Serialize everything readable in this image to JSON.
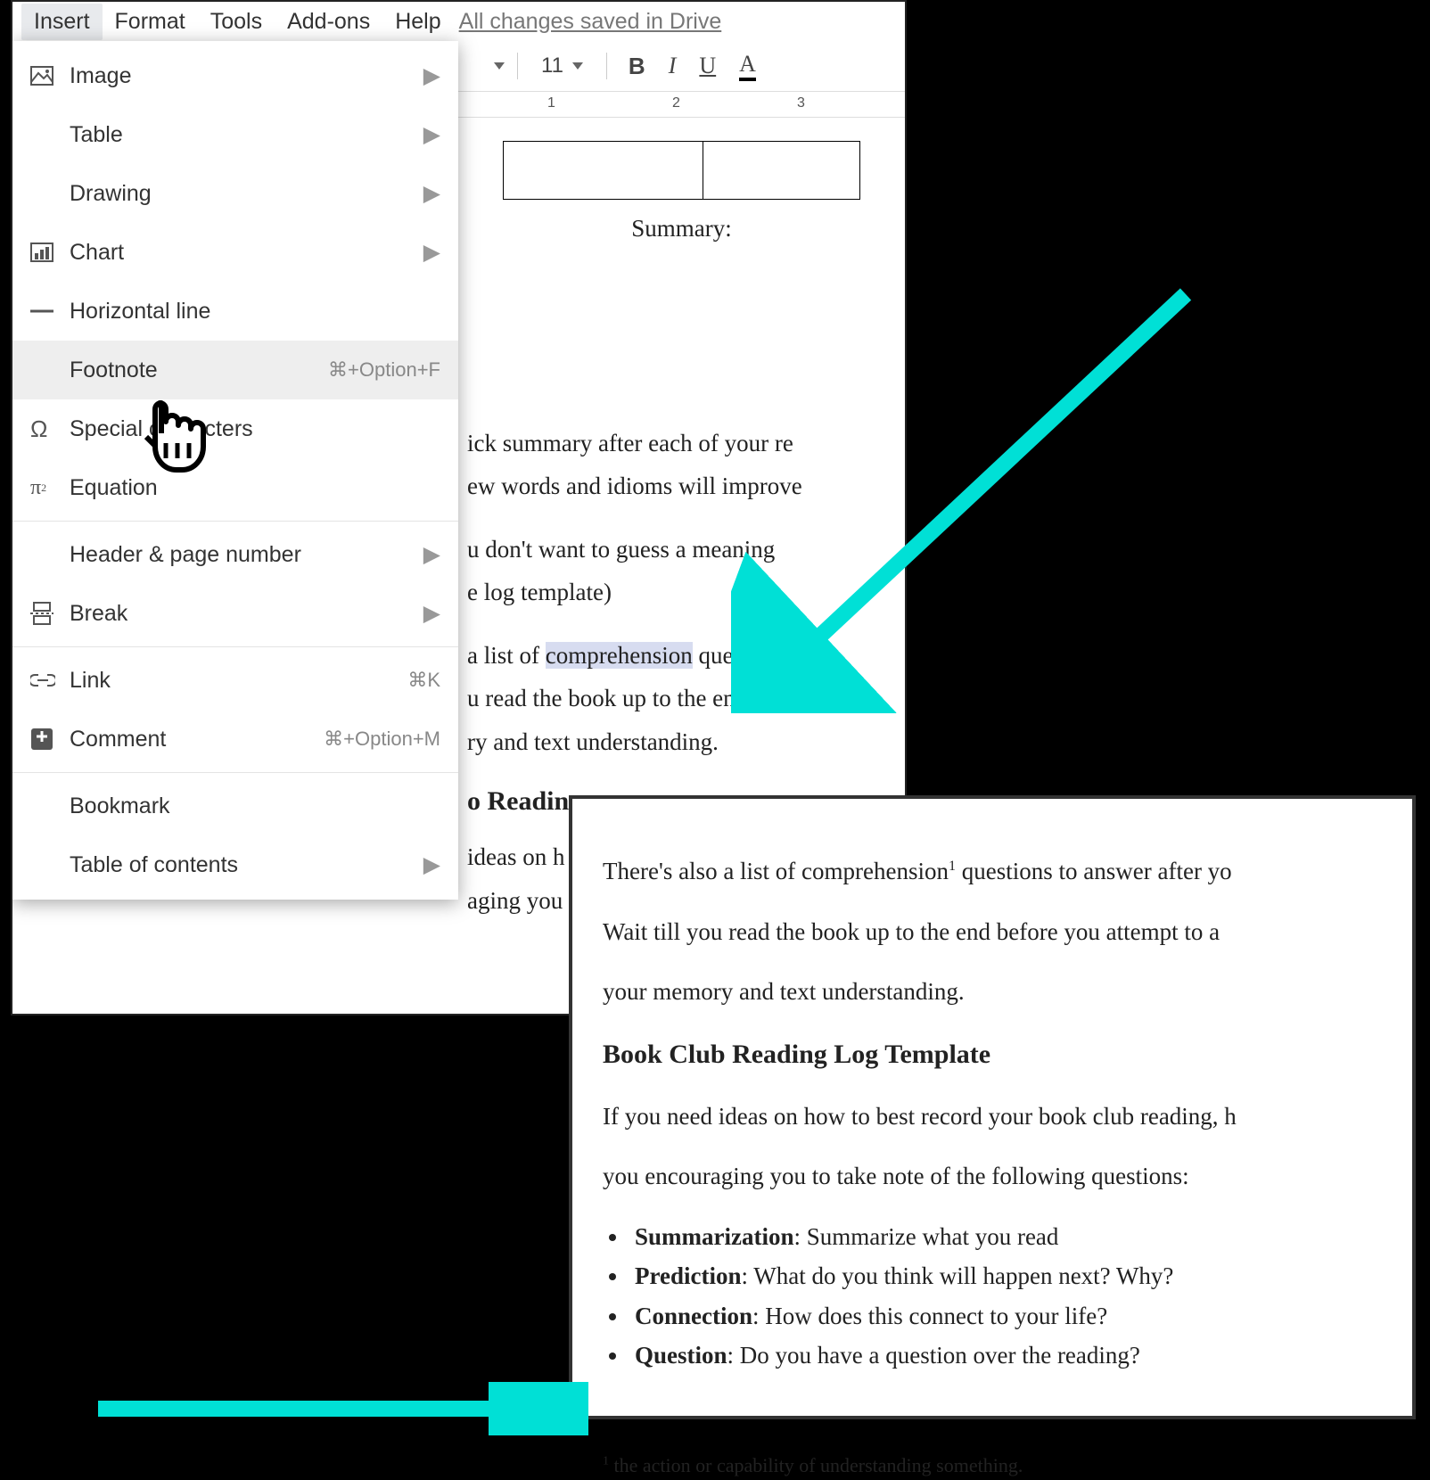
{
  "menubar": {
    "items": [
      "Insert",
      "Format",
      "Tools",
      "Add-ons",
      "Help"
    ],
    "active_index": 0,
    "save_status": "All changes saved in Drive"
  },
  "toolbar": {
    "font_size": "11",
    "format_buttons": {
      "bold": "B",
      "italic": "I",
      "underline": "U",
      "textcolor": "A"
    }
  },
  "ruler": {
    "marks": [
      "1",
      "2",
      "3"
    ]
  },
  "insert_menu": {
    "items": [
      {
        "icon": "image",
        "label": "Image",
        "submenu": true
      },
      {
        "icon": "",
        "label": "Table",
        "submenu": true
      },
      {
        "icon": "",
        "label": "Drawing",
        "submenu": true
      },
      {
        "icon": "chart",
        "label": "Chart",
        "submenu": true
      },
      {
        "icon": "hline",
        "label": "Horizontal line"
      },
      {
        "icon": "",
        "label": "Footnote",
        "shortcut": "⌘+Option+F",
        "hover": true
      },
      {
        "icon": "omega",
        "label": "Special characters"
      },
      {
        "icon": "pi",
        "label": "Equation"
      },
      {
        "sep": true
      },
      {
        "icon": "",
        "label": "Header & page number",
        "submenu": true
      },
      {
        "icon": "break",
        "label": "Break",
        "submenu": true
      },
      {
        "sep": true
      },
      {
        "icon": "link",
        "label": "Link",
        "shortcut": "⌘K"
      },
      {
        "icon": "comment",
        "label": "Comment",
        "shortcut": "⌘+Option+M"
      },
      {
        "sep": true
      },
      {
        "icon": "",
        "label": "Bookmark"
      },
      {
        "icon": "",
        "label": "Table of contents",
        "submenu": true
      }
    ]
  },
  "doc_a": {
    "summary_label": "Summary:",
    "p1a": "ick summary after each of your re",
    "p1b": "ew words and idioms will improve",
    "p2a": "u don't want to guess a meaning ",
    "p2b": "e log template)",
    "p3a": " a list of ",
    "highlight": "comprehension",
    "p3b": " questions",
    "p3c": "u read the book up to the end befo",
    "p3d": "ry and text understanding.",
    "h": "o Readin",
    "p4a": "ideas on h",
    "p4b": "aging you"
  },
  "doc_b": {
    "p1": "There's also a list of comprehension",
    "p1_after": " questions to answer after yo",
    "p2": "Wait till you read the book up to the end before you attempt to a",
    "p3": "your memory and text understanding.",
    "heading": "Book Club Reading Log Template",
    "p4": "If you need ideas on how to best record your book club reading, h",
    "p5": "you encouraging you to take note of the following questions:",
    "bullets": [
      {
        "b": "Summarization",
        "t": ": Summarize what you read"
      },
      {
        "b": "Prediction",
        "t": ": What do you think will happen next? Why?"
      },
      {
        "b": "Connection",
        "t": ": How does this connect to your life?"
      },
      {
        "b": "Question",
        "t": ": Do you have a question over the reading?"
      }
    ],
    "footnote_num": "1",
    "footnote_text": " the action or capability of understanding something."
  },
  "colors": {
    "arrow": "#00e0d6"
  }
}
